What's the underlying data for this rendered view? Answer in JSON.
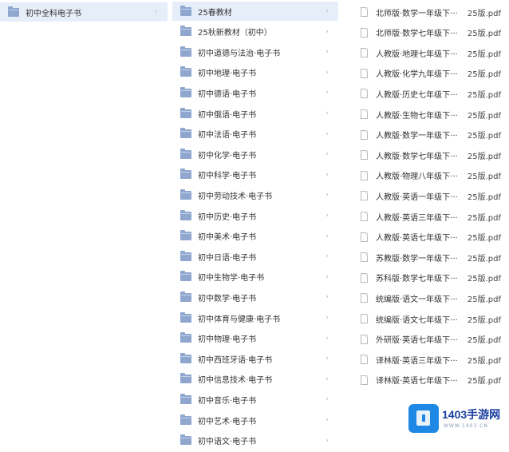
{
  "col1": {
    "items": [
      {
        "label": "初中全科电子书"
      }
    ]
  },
  "col2": {
    "items": [
      {
        "label": "25春教材"
      },
      {
        "label": "25秋新教材（初中）"
      },
      {
        "label": "初中道德与法治·电子书"
      },
      {
        "label": "初中地理·电子书"
      },
      {
        "label": "初中德语·电子书"
      },
      {
        "label": "初中俄语·电子书"
      },
      {
        "label": "初中法语·电子书"
      },
      {
        "label": "初中化学·电子书"
      },
      {
        "label": "初中科学·电子书"
      },
      {
        "label": "初中劳动技术·电子书"
      },
      {
        "label": "初中历史·电子书"
      },
      {
        "label": "初中美术·电子书"
      },
      {
        "label": "初中日语·电子书"
      },
      {
        "label": "初中生物学·电子书"
      },
      {
        "label": "初中数学·电子书"
      },
      {
        "label": "初中体育与健康·电子书"
      },
      {
        "label": "初中物理·电子书"
      },
      {
        "label": "初中西班牙语·电子书"
      },
      {
        "label": "初中信息技术·电子书"
      },
      {
        "label": "初中音乐·电子书"
      },
      {
        "label": "初中艺术·电子书"
      },
      {
        "label": "初中语文·电子书"
      }
    ]
  },
  "col3": {
    "items": [
      {
        "name": "北师版·数学一年级下···",
        "ext": "25版.pdf"
      },
      {
        "name": "北师版·数学七年级下···",
        "ext": "25版.pdf"
      },
      {
        "name": "人教版·地理七年级下···",
        "ext": "25版.pdf"
      },
      {
        "name": "人教版·化学九年级下···",
        "ext": "25版.pdf"
      },
      {
        "name": "人教版·历史七年级下···",
        "ext": "25版.pdf"
      },
      {
        "name": "人教版·生物七年级下···",
        "ext": "25版.pdf"
      },
      {
        "name": "人教版·数学一年级下···",
        "ext": "25版.pdf"
      },
      {
        "name": "人教版·数学七年级下···",
        "ext": "25版.pdf"
      },
      {
        "name": "人教版·物理八年级下···",
        "ext": "25版.pdf"
      },
      {
        "name": "人教版·英语一年级下···",
        "ext": "25版.pdf"
      },
      {
        "name": "人教版·英语三年级下···",
        "ext": "25版.pdf"
      },
      {
        "name": "人教版·英语七年级下···",
        "ext": "25版.pdf"
      },
      {
        "name": "苏教版·数学一年级下···",
        "ext": "25版.pdf"
      },
      {
        "name": "苏科版·数学七年级下···",
        "ext": "25版.pdf"
      },
      {
        "name": "统编版·语文一年级下···",
        "ext": "25版.pdf"
      },
      {
        "name": "统编版·语文七年级下···",
        "ext": "25版.pdf"
      },
      {
        "name": "外研版·英语七年级下···",
        "ext": "25版.pdf"
      },
      {
        "name": "译林版·英语三年级下···",
        "ext": "25版.pdf"
      },
      {
        "name": "译林版·英语七年级下···",
        "ext": "25版.pdf"
      }
    ]
  },
  "watermark": {
    "title": "1403手游网",
    "sub": "WWW.1403.CN"
  },
  "colors": {
    "selected_row": "#e6eef9",
    "folder_icon": "#8fa7cf",
    "watermark_blue": "#1f88e5"
  }
}
